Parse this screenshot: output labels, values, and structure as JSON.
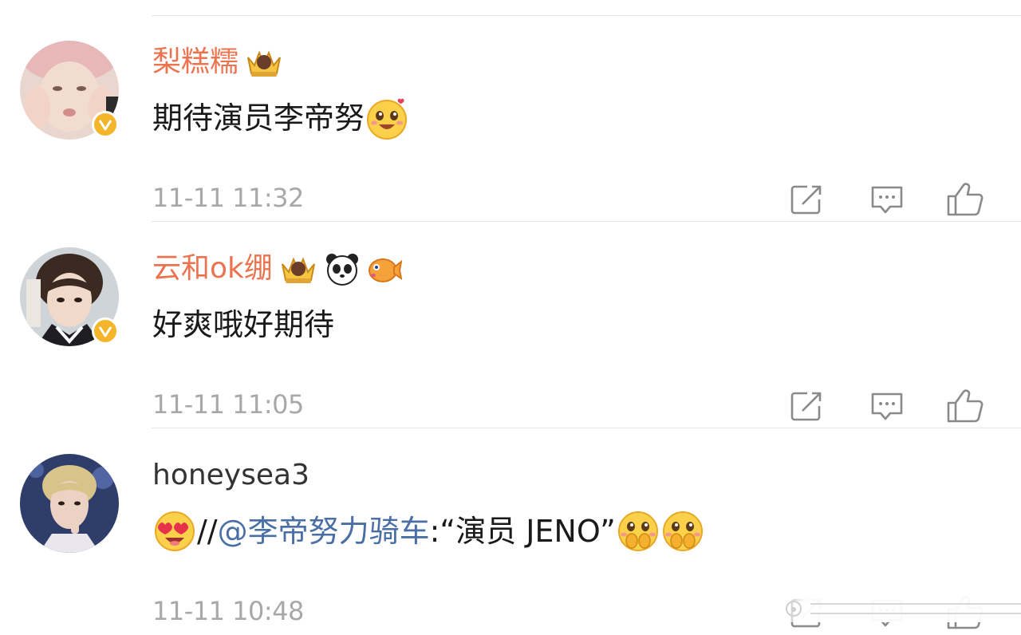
{
  "comments": [
    {
      "username": "梨糕糯",
      "text": "期待演员李帝努",
      "timestamp": "11-11 11:32",
      "badges": [
        "crown-badge-icon"
      ],
      "emojis": [
        "heart-eyes-blush-emoji"
      ],
      "verified": true
    },
    {
      "username": "云和ok绷",
      "text": "好爽哦好期待",
      "timestamp": "11-11 11:05",
      "badges": [
        "crown-badge-icon",
        "panda-icon",
        "pufferfish-icon"
      ],
      "verified": true
    },
    {
      "username": "honeysea3",
      "text_prefix": "//",
      "mention": "@李帝努力骑车",
      "text_suffix": ":“演员 JENO”",
      "timestamp": "11-11 10:48",
      "emojis": [
        "heart-eyes-face-emoji",
        "pleading-hands-emoji",
        "pleading-hands-emoji"
      ],
      "verified": false
    }
  ],
  "actions": {
    "share_icon": "share-square-icon",
    "reply_icon": "comment-bubble-icon",
    "like_icon": "thumbs-up-icon"
  },
  "colors": {
    "username_orange": "#eb7350",
    "mention_blue": "#4a6fa5",
    "timestamp_gray": "#a8a8a8",
    "icon_gray": "#8a8a8a",
    "verified_yellow": "#f4b52a",
    "divider": "#e6e6e6"
  }
}
